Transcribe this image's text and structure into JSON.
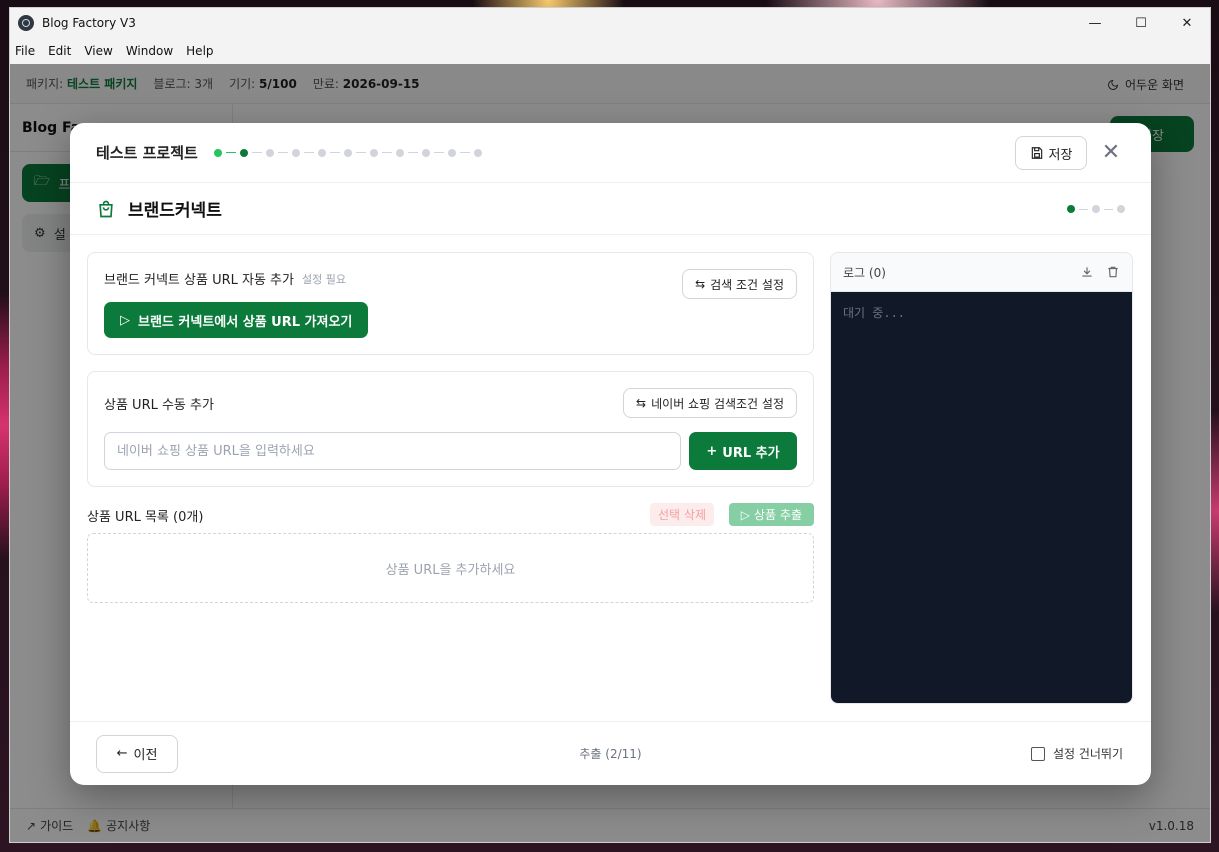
{
  "window": {
    "title": "Blog Factory V3"
  },
  "menu": [
    "File",
    "Edit",
    "View",
    "Window",
    "Help"
  ],
  "status": {
    "package_label": "패키지:",
    "package_value": "테스트 패키지",
    "blog": "블로그: 3개",
    "devices_label": "기기:",
    "devices_value": "5/100",
    "expire_label": "만료:",
    "expire_value": "2026-09-15",
    "dark_mode": "어두운 화면"
  },
  "sidebar": {
    "brand": "Blog Fa",
    "item1": "프",
    "item2": "설"
  },
  "top_save_partial": "저장",
  "footer": {
    "guide": "가이드",
    "notice": "공지사항",
    "version": "v1.0.18"
  },
  "modal": {
    "title": "테스트 프로젝트",
    "save": "저장",
    "section_title": "브랜드커넥트",
    "auto_card": {
      "title": "브랜드 커넥트 상품 URL 자동 추가",
      "hint": "설정 필요",
      "settings_button": "검색 조건 설정",
      "fetch_button": "브랜드 커넥트에서 상품 URL 가져오기"
    },
    "manual_card": {
      "title": "상품 URL 수동 추가",
      "settings_button": "네이버 쇼핑 검색조건 설정",
      "input_placeholder": "네이버 쇼핑 상품 URL을 입력하세요",
      "add_button": "URL 추가"
    },
    "list": {
      "title": "상품 URL 목록 (0개)",
      "delete_button": "선택 삭제",
      "extract_button": "상품 추출",
      "empty": "상품 URL을 추가하세요"
    },
    "log": {
      "title": "로그 (0)",
      "body": "대기 중..."
    },
    "footer": {
      "prev": "이전",
      "progress": "추출 (2/11)",
      "skip": "설정 건너뛰기"
    }
  },
  "colors": {
    "accent": "#0b7a3b",
    "log_bg": "#111827"
  }
}
